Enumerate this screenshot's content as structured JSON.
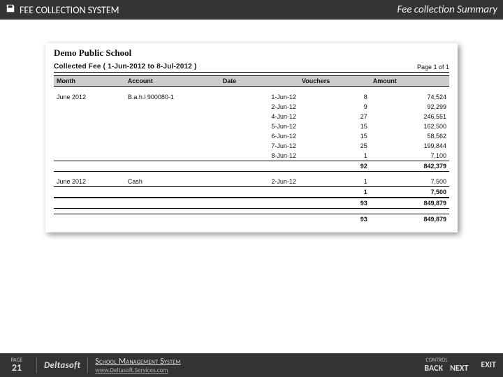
{
  "header": {
    "title": "FEE COLLECTION SYSTEM",
    "subtitle": "Fee collection Summary"
  },
  "report": {
    "school": "Demo Public School",
    "range_title": "Collected Fee ( 1-Jun-2012 to 8-Jul-2012 )",
    "page_of": "Page 1 of 1",
    "columns": {
      "month": "Month",
      "account": "Account",
      "date": "Date",
      "vouchers": "Vouchers",
      "amount": "Amount"
    },
    "group1": {
      "month": "June 2012",
      "account": "B.a.h.l 900080-1",
      "rows": [
        {
          "date": "1-Jun-12",
          "vouchers": "8",
          "amount": "74,524"
        },
        {
          "date": "2-Jun-12",
          "vouchers": "9",
          "amount": "92,299"
        },
        {
          "date": "4-Jun-12",
          "vouchers": "27",
          "amount": "246,551"
        },
        {
          "date": "5-Jun-12",
          "vouchers": "15",
          "amount": "162,500"
        },
        {
          "date": "6-Jun-12",
          "vouchers": "15",
          "amount": "58,562"
        },
        {
          "date": "7-Jun-12",
          "vouchers": "25",
          "amount": "199,844"
        },
        {
          "date": "8-Jun-12",
          "vouchers": "1",
          "amount": "7,100"
        }
      ],
      "sub": {
        "vouchers": "92",
        "amount": "842,379"
      }
    },
    "group2": {
      "month": "June 2012",
      "account": "Cash",
      "rows": [
        {
          "date": "2-Jun-12",
          "vouchers": "1",
          "amount": "7,500"
        }
      ],
      "sub": {
        "vouchers": "1",
        "amount": "7,500"
      }
    },
    "grand": {
      "vouchers": "93",
      "amount": "849,879"
    },
    "grand2": {
      "vouchers": "93",
      "amount": "849,879"
    }
  },
  "footer": {
    "page_label": "PAGE",
    "page_num": "21",
    "brand": "Deltasoft",
    "product": "School Management System",
    "url": "www.Deltasoft.Services.com",
    "control_label": "CONTROL",
    "back": "BACK",
    "next": "NEXT",
    "exit": "EXIT"
  }
}
